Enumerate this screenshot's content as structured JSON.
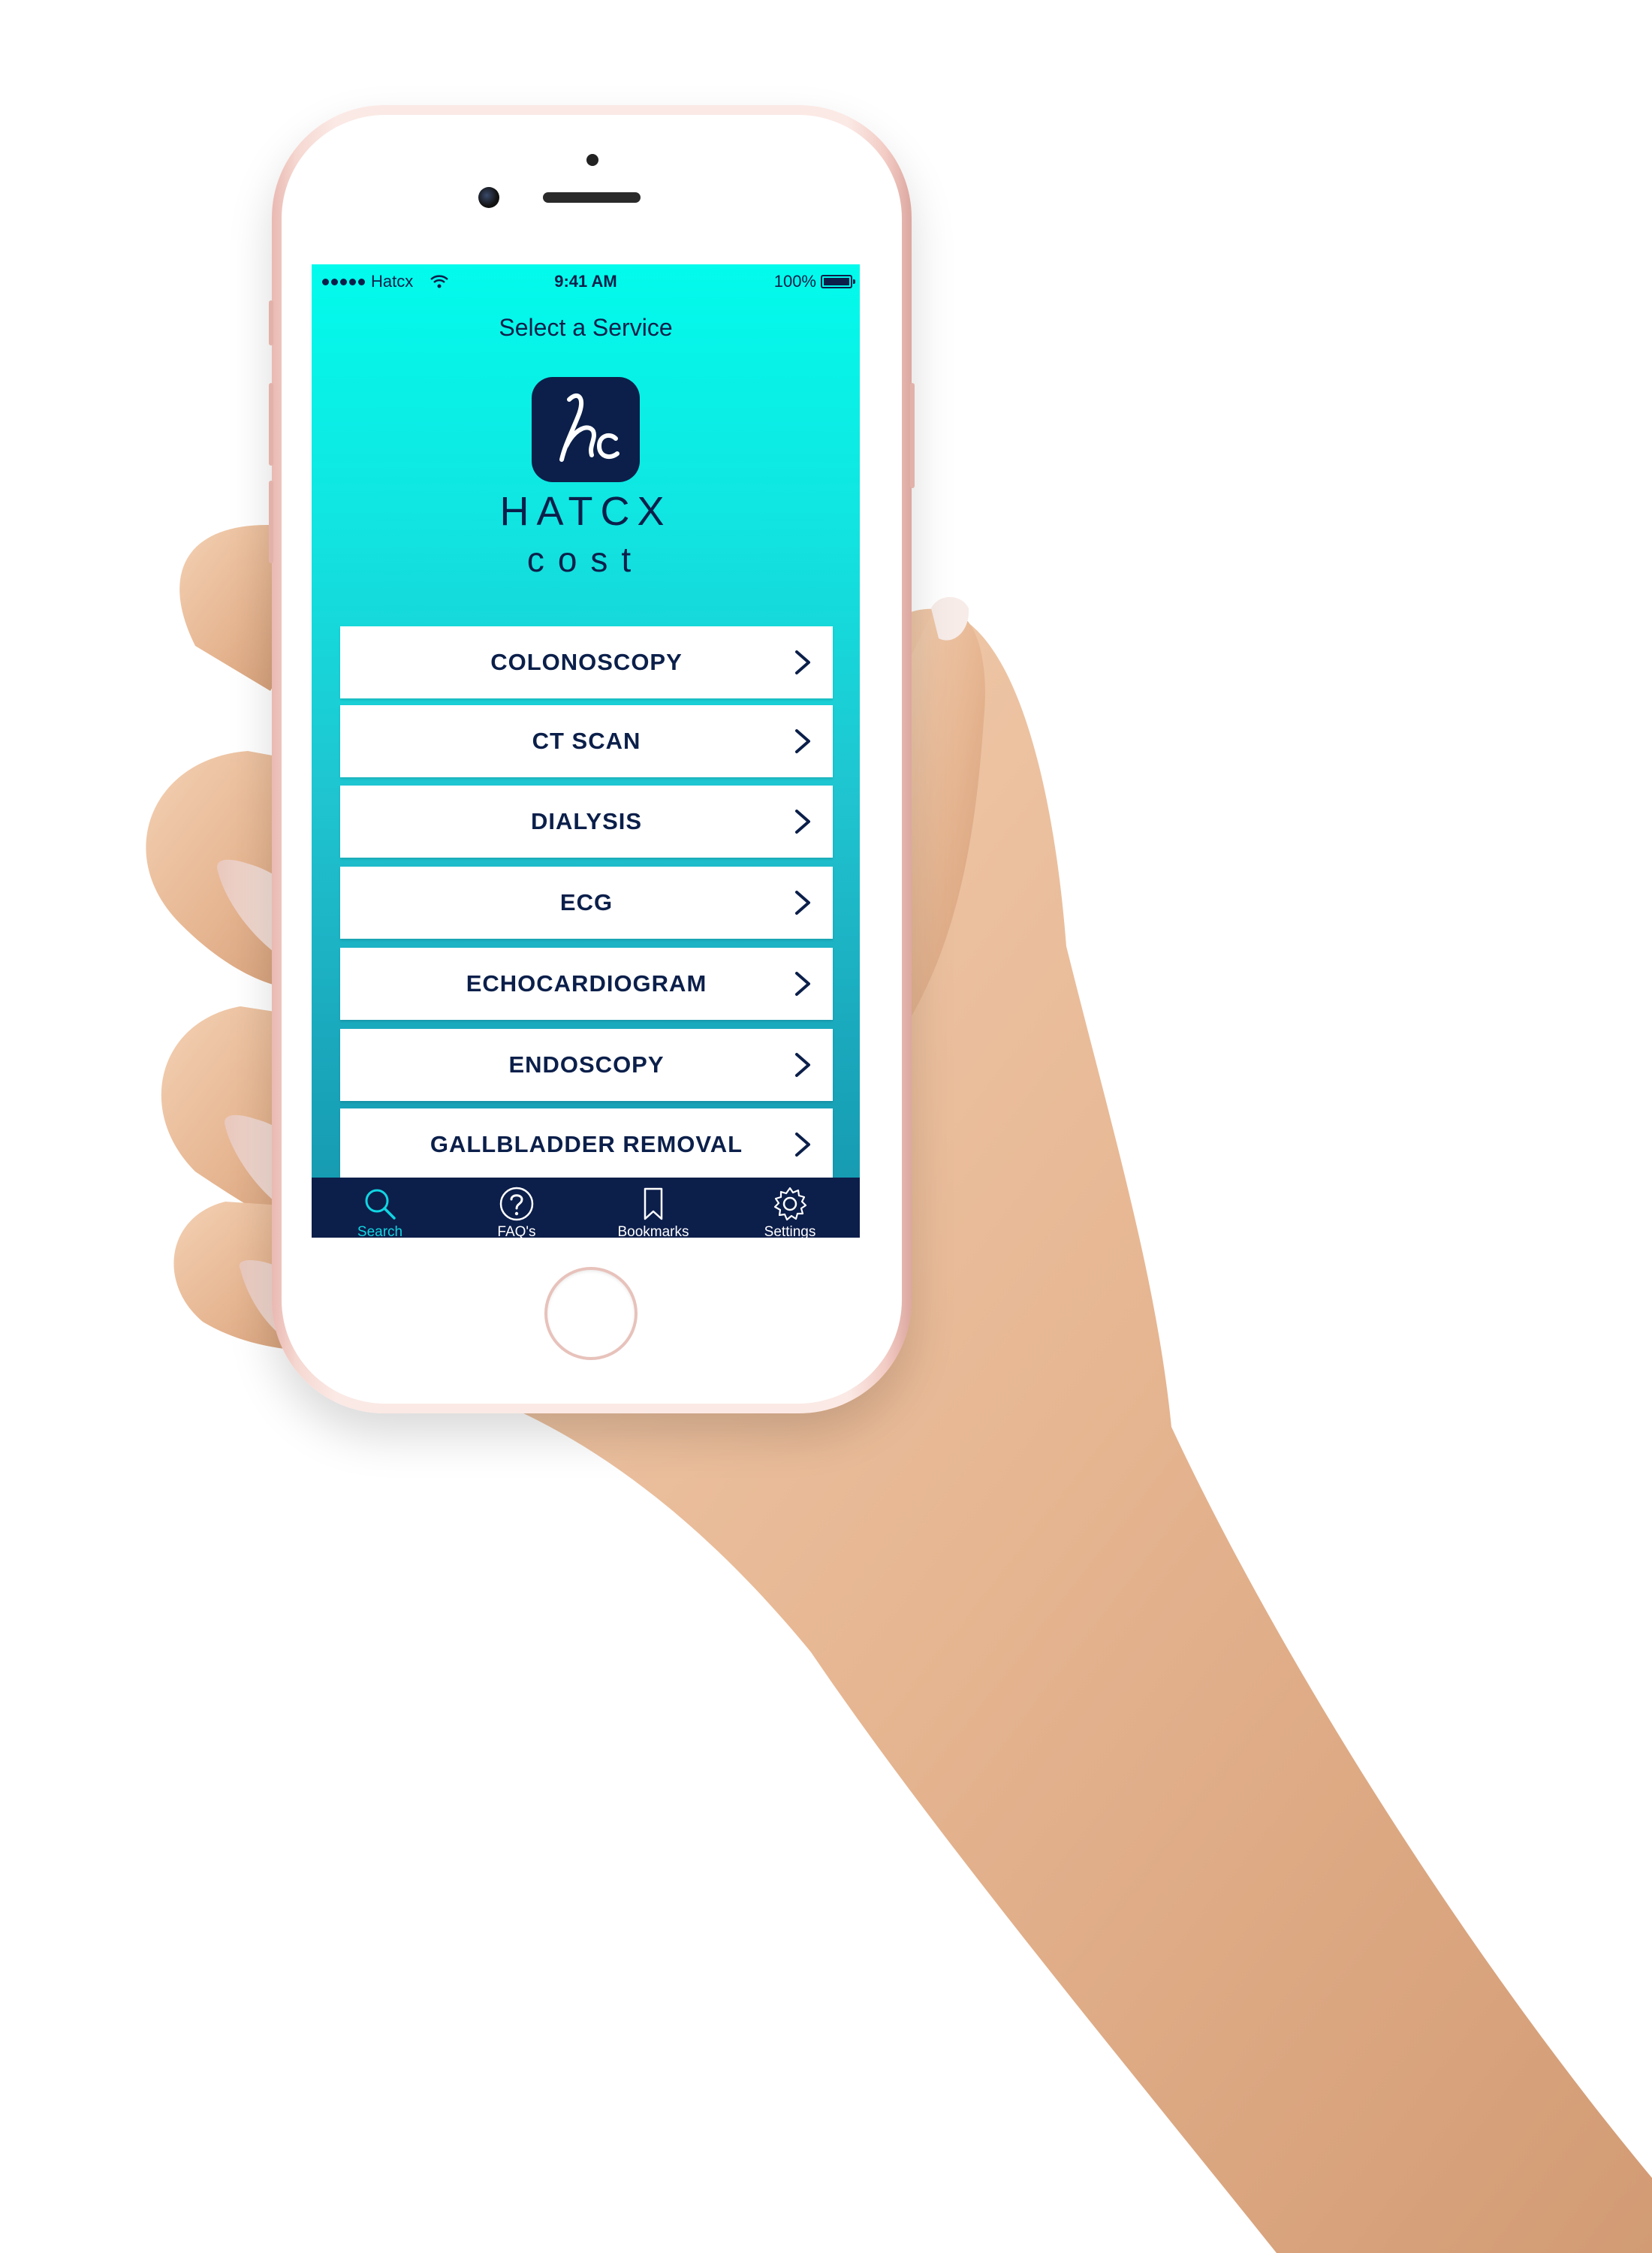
{
  "status_bar": {
    "carrier": "Hatcx",
    "time": "9:41 AM",
    "battery": "100%"
  },
  "nav": {
    "title": "Select a Service"
  },
  "brand": {
    "logo_text": "hc",
    "name": "HATCX",
    "sub": "cost"
  },
  "services": [
    {
      "label": "COLONOSCOPY"
    },
    {
      "label": "CT SCAN"
    },
    {
      "label": "DIALYSIS"
    },
    {
      "label": "ECG"
    },
    {
      "label": "ECHOCARDIOGRAM"
    },
    {
      "label": "ENDOSCOPY"
    },
    {
      "label": "GALLBLADDER REMOVAL"
    }
  ],
  "tabs": [
    {
      "label": "Search",
      "icon": "search-icon",
      "active": true
    },
    {
      "label": "FAQ's",
      "icon": "question-icon",
      "active": false
    },
    {
      "label": "Bookmarks",
      "icon": "bookmark-icon",
      "active": false
    },
    {
      "label": "Settings",
      "icon": "gear-icon",
      "active": false
    }
  ],
  "colors": {
    "navy": "#0b1f4a",
    "gradient_top": "#02fbec",
    "gradient_bottom": "#1596ad",
    "tab_active": "#11d5e2",
    "phone_frame": "#fbe9e5"
  }
}
